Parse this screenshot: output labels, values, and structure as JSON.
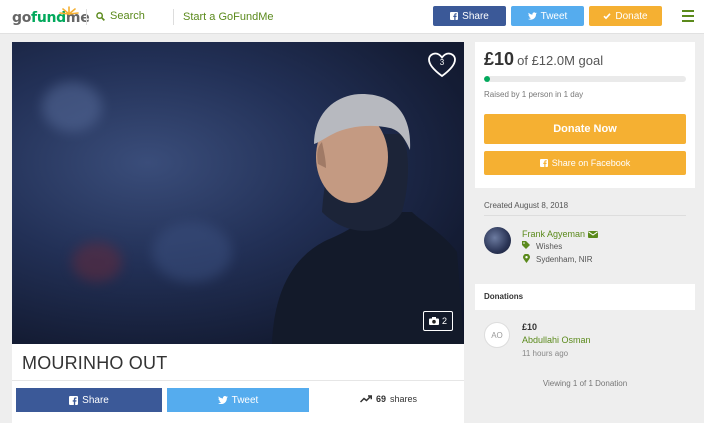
{
  "header": {
    "logo": {
      "go": "go",
      "fund": "fund",
      "me": "me"
    },
    "search_label": "Search",
    "start_label": "Start a GoFundMe",
    "share_label": "Share",
    "tweet_label": "Tweet",
    "donate_label": "Donate"
  },
  "campaign": {
    "heart_count": "3",
    "photo_count": "2",
    "title": "MOURINHO OUT",
    "share_label": "Share",
    "tweet_label": "Tweet",
    "shares_count": "69",
    "shares_word": "shares"
  },
  "donate_panel": {
    "raised_amount": "£10",
    "goal_text": "of £12.0M goal",
    "progress": 0.03,
    "raised_by": "Raised by 1 person in 1 day",
    "donate_now_label": "Donate Now",
    "fb_share_label": "Share on Facebook"
  },
  "organizer": {
    "created": "Created August 8, 2018",
    "name": "Frank Agyeman",
    "category": "Wishes",
    "location": "Sydenham, NIR"
  },
  "donations": {
    "title": "Donations",
    "items": [
      {
        "initials": "AO",
        "amount": "£10",
        "name": "Abdullahi Osman",
        "time": "11 hours ago"
      }
    ],
    "viewing": "Viewing 1 of 1 Donation"
  },
  "colors": {
    "brand_green": "#02a95c",
    "link_green": "#5b8a1c",
    "facebook": "#3b5998",
    "twitter": "#55acee",
    "donate": "#f5b032"
  }
}
